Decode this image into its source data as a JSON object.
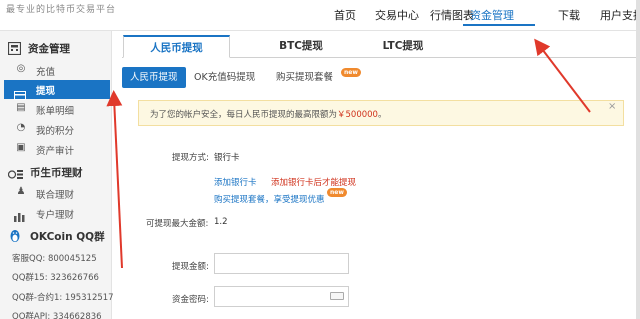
{
  "header": {
    "slogan": "最专业的比特币交易平台",
    "nav": [
      {
        "label": "首页"
      },
      {
        "label": "交易中心"
      },
      {
        "label": "行情图表"
      },
      {
        "label": "资金管理",
        "active": true
      },
      {
        "label": "下载"
      },
      {
        "label": "用户支持"
      }
    ]
  },
  "sidebar": {
    "section1": {
      "title": "资金管理",
      "icon": "calculator-icon"
    },
    "items1": [
      {
        "label": "充值",
        "icon": "coins-icon"
      },
      {
        "label": "提现",
        "icon": "withdraw-card-icon",
        "active": true
      },
      {
        "label": "账单明细",
        "icon": "bill-icon"
      },
      {
        "label": "我的积分",
        "icon": "pie-icon"
      },
      {
        "label": "资产审计",
        "icon": "audit-icon"
      }
    ],
    "section2": {
      "title": "币生币理财",
      "icon": "coin-stack-icon"
    },
    "items2": [
      {
        "label": "联合理财",
        "icon": "group-user-icon"
      },
      {
        "label": "专户理财",
        "icon": "bar-chart-icon"
      }
    ],
    "qq": {
      "title": "OKCoin QQ群",
      "icon": "penguin-icon",
      "lines": [
        "客服QQ: 800045125",
        "QQ群15: 323626766",
        "QQ群-合约1: 195312517",
        "QQ群API: 334662836"
      ]
    }
  },
  "main": {
    "tabs": [
      {
        "label": "人民币提现",
        "active": true
      },
      {
        "label": "BTC提现"
      },
      {
        "label": "LTC提现"
      }
    ],
    "subtabs": [
      {
        "label": "人民币提现",
        "active": true
      },
      {
        "label": "OK充值码提现"
      },
      {
        "label": "购买提现套餐",
        "badge": "new"
      }
    ],
    "notice": {
      "text_before": "为了您的帐户安全，每日人民币提现的最高限额为",
      "amount": "￥500000",
      "text_after": "。",
      "close": "×"
    },
    "form": {
      "method_label": "提现方式:",
      "method_value": "银行卡",
      "add_card": "添加银行卡",
      "add_card_hint": "添加银行卡后才能提现",
      "buy_plan": "购买提现套餐，享受提现优惠",
      "buy_plan_badge": "new",
      "max_label": "可提现最大金额:",
      "max_value": "1.2",
      "amount_label": "提现金额:",
      "amount_value": "",
      "password_label": "资金密码:",
      "password_value": ""
    }
  },
  "colors": {
    "accent": "#1a74c4",
    "warning": "#d0321c",
    "badge": "#f08a2e",
    "arrow": "#e0392b"
  }
}
